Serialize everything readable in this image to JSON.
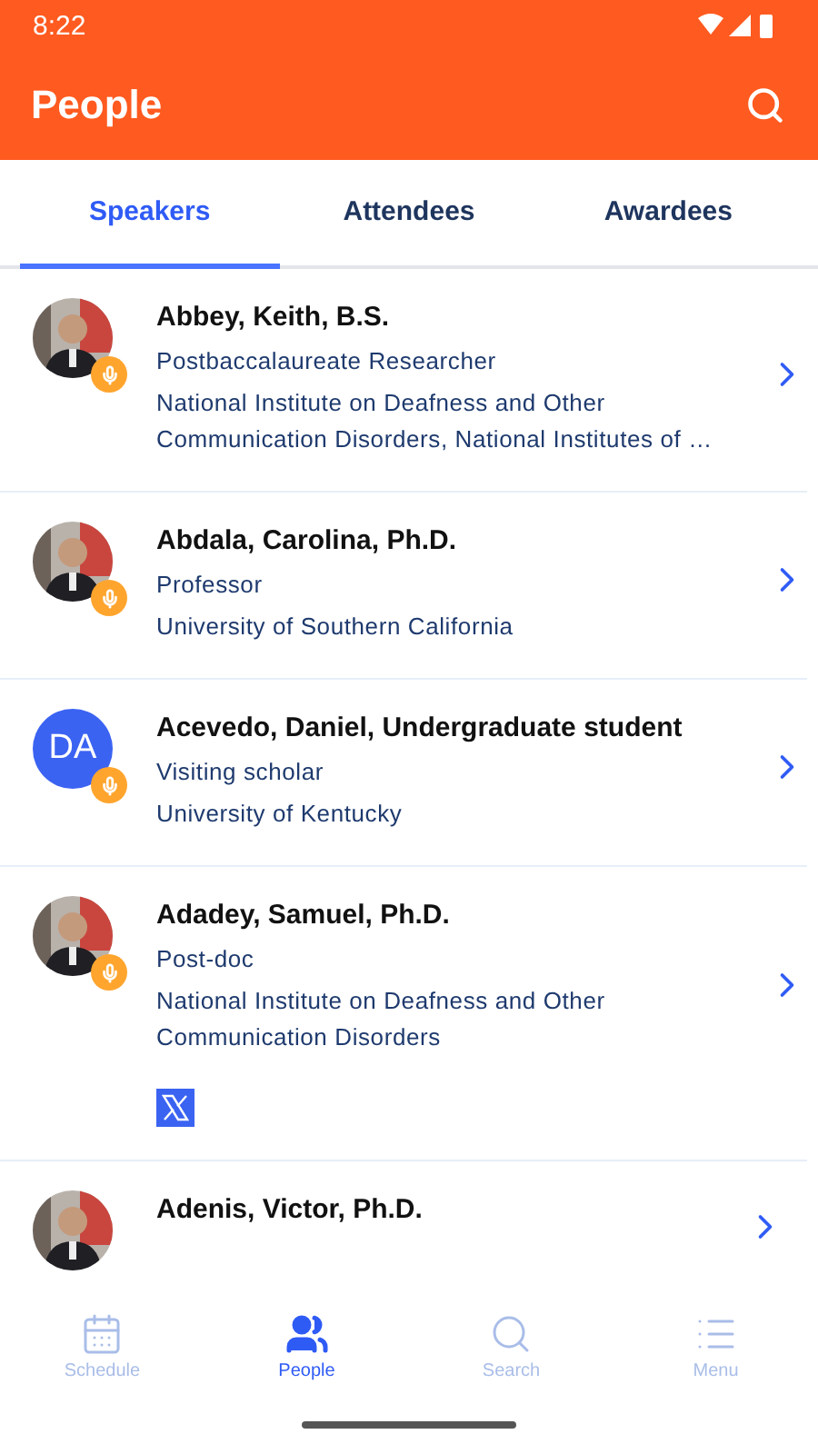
{
  "status_bar": {
    "time": "8:22"
  },
  "header": {
    "title": "People"
  },
  "tabs": [
    {
      "label": "Speakers",
      "selected": true
    },
    {
      "label": "Attendees",
      "selected": false
    },
    {
      "label": "Awardees",
      "selected": false
    }
  ],
  "people": [
    {
      "name": "Abbey, Keith, B.S.",
      "speaker": true,
      "role": "Postbaccalaureate Researcher",
      "affiliation": "National Institute on Deafness and Other Communication Disorders, National Institutes of …"
    },
    {
      "name": "Abdala, Carolina, Ph.D.",
      "speaker": true,
      "role": "Professor",
      "affiliation": "University of Southern California"
    },
    {
      "name": "Acevedo, Daniel, Undergraduate student",
      "avatar": {
        "kind": "initials",
        "initials": "DA"
      },
      "speaker": true,
      "role": "Visiting scholar",
      "affiliation": "University of Kentucky"
    },
    {
      "name": "Adadey, Samuel, Ph.D.",
      "speaker": true,
      "role": "Post-doc",
      "affiliation": "National Institute on Deafness and Other Communication Disorders",
      "social": true
    },
    {
      "name": "Adenis, Victor, Ph.D."
    }
  ],
  "bottom_nav": [
    {
      "label": "Schedule",
      "kind": "calendar",
      "selected": false
    },
    {
      "label": "People",
      "kind": "people",
      "selected": true
    },
    {
      "label": "Search",
      "kind": "search",
      "selected": false
    },
    {
      "label": "Menu",
      "kind": "menu",
      "selected": false
    }
  ]
}
